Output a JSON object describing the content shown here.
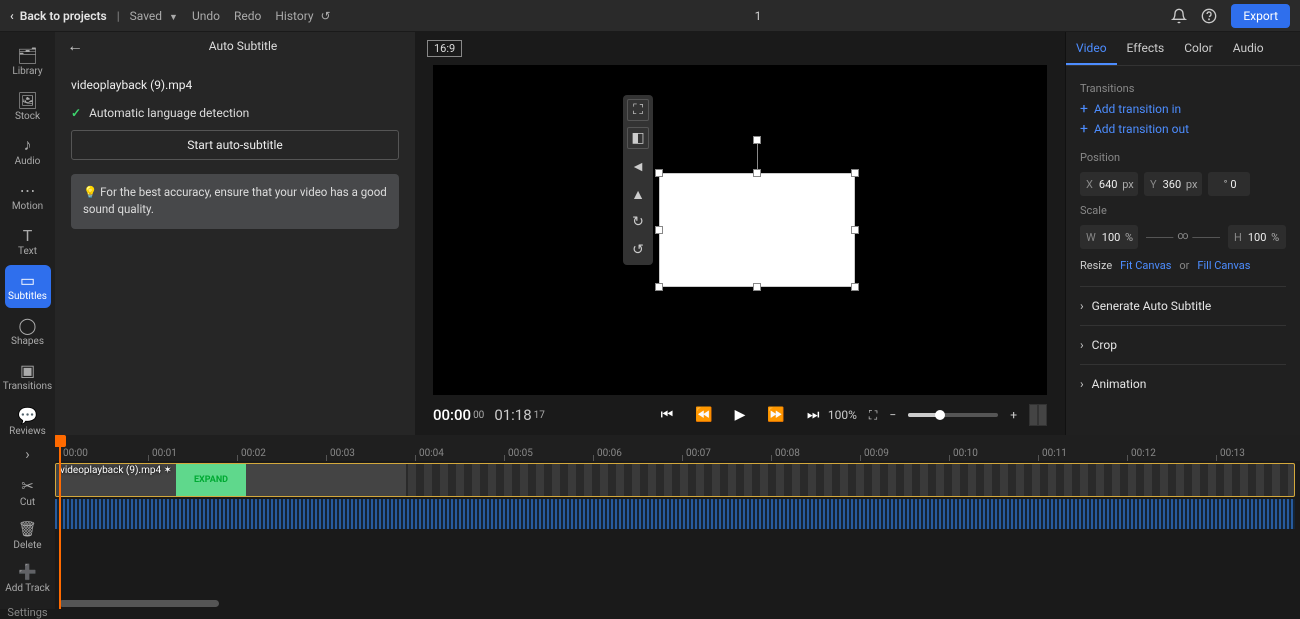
{
  "topbar": {
    "back": "Back to projects",
    "saved": "Saved",
    "undo": "Undo",
    "redo": "Redo",
    "history": "History",
    "title": "1",
    "export": "Export"
  },
  "leftnav": {
    "library": "Library",
    "stock": "Stock",
    "audio": "Audio",
    "motion": "Motion",
    "text": "Text",
    "subtitles": "Subtitles",
    "shapes": "Shapes",
    "transitions": "Transitions",
    "reviews": "Reviews"
  },
  "panel": {
    "title": "Auto Subtitle",
    "filename": "videoplayback (9).mp4",
    "lang_detect": "Automatic language detection",
    "start_btn": "Start auto-subtitle",
    "tip": "💡 For the best accuracy, ensure that your video has a good sound quality."
  },
  "aspect": "16:9",
  "playback": {
    "current": "00:00",
    "current_sub": "00",
    "total": "01:18",
    "total_sub": "17",
    "zoom": "100%"
  },
  "right": {
    "tabs": {
      "video": "Video",
      "effects": "Effects",
      "color": "Color",
      "audio": "Audio"
    },
    "transitions_label": "Transitions",
    "add_in": "Add transition in",
    "add_out": "Add transition out",
    "position_label": "Position",
    "pos_x": "640",
    "pos_x_unit": "px",
    "pos_y": "360",
    "pos_y_unit": "px",
    "rot_unit": "°",
    "rot_val": "0",
    "scale_label": "Scale",
    "scale_w": "100",
    "scale_w_unit": "%",
    "scale_h": "100",
    "scale_h_unit": "%",
    "resize_label": "Resize",
    "fit_canvas": "Fit Canvas",
    "or": "or",
    "fill_canvas": "Fill Canvas",
    "gen_auto_sub": "Generate Auto Subtitle",
    "crop": "Crop",
    "animation": "Animation"
  },
  "timeline": {
    "cut": "Cut",
    "delete": "Delete",
    "add_track": "Add Track",
    "settings": "Settings",
    "clip_label": "videoplayback (9).mp4",
    "marks": [
      "00:00",
      "00:01",
      "00:02",
      "00:03",
      "00:04",
      "00:05",
      "00:06",
      "00:07",
      "00:08",
      "00:09",
      "00:10",
      "00:11",
      "00:12",
      "00:13"
    ],
    "expand_label": "EXPAND"
  }
}
